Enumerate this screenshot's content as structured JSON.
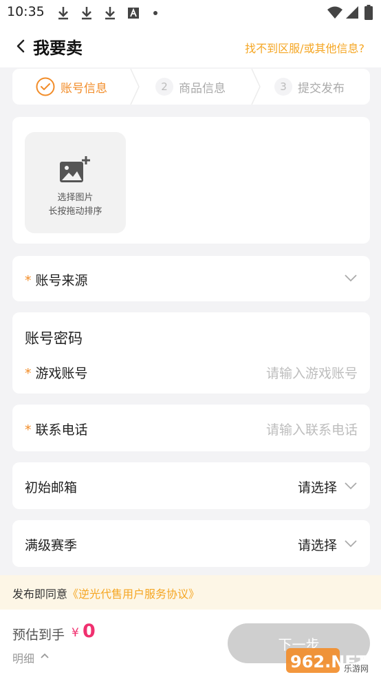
{
  "status_bar": {
    "time": "10:35"
  },
  "header": {
    "title": "我要卖",
    "help_link": "找不到区服/或其他信息?"
  },
  "steps": [
    {
      "num": "",
      "label": "账号信息"
    },
    {
      "num": "2",
      "label": "商品信息"
    },
    {
      "num": "3",
      "label": "提交发布"
    }
  ],
  "upload": {
    "line1": "选择图片",
    "line2": "长按拖动排序"
  },
  "account_source": {
    "required_mark": "*",
    "label": "账号来源"
  },
  "account_password": {
    "section_title": "账号密码",
    "game_account": {
      "required_mark": "*",
      "label": "游戏账号",
      "placeholder": "请输入游戏账号"
    }
  },
  "contact_phone": {
    "required_mark": "*",
    "label": "联系电话",
    "placeholder": "请输入联系电话"
  },
  "initial_email": {
    "label": "初始邮箱",
    "value": "请选择"
  },
  "max_season": {
    "label": "满级赛季",
    "value": "请选择"
  },
  "agreement": {
    "prefix": "发布即同意",
    "link": "《逆光代售用户服务协议》"
  },
  "footer": {
    "estimate_label": "预估到手",
    "currency": "¥",
    "amount": "0",
    "detail": "明细",
    "next_button": "下一步"
  },
  "watermark": {
    "text": "962.NET",
    "subtext": "乐游网"
  },
  "colors": {
    "accent": "#f28c28",
    "link": "#f5a623",
    "price": "#f0306f",
    "disabled_button": "#cfcfcf"
  }
}
